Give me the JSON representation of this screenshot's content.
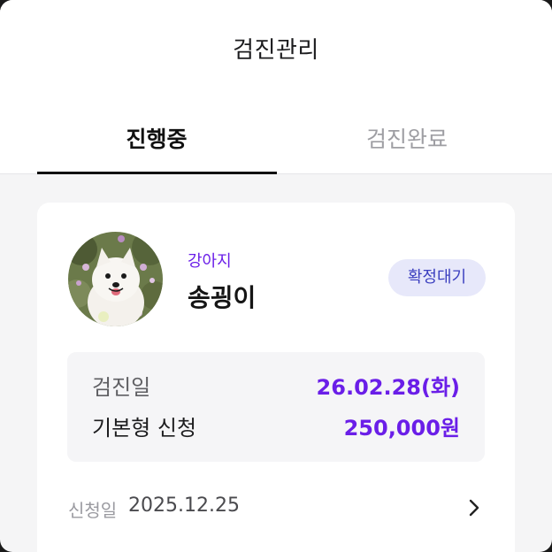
{
  "header": {
    "title": "검진관리"
  },
  "tabs": [
    {
      "label": "진행중",
      "active": true
    },
    {
      "label": "검진완료",
      "active": false
    }
  ],
  "card": {
    "species": "강아지",
    "pet_name": "송굉이",
    "status_badge": "확정대기",
    "info": {
      "exam_date_label": "검진일",
      "exam_date_value": "26.02.28(화)",
      "plan_label": "기본형 신청",
      "plan_value": "250,000원"
    },
    "apply_label": "신청일",
    "apply_date": "2025.12.25"
  },
  "colors": {
    "accent": "#6a1ee8",
    "badge_bg": "#e7e8fa",
    "badge_text": "#3b3fbf",
    "page_bg": "#f5f5f6"
  },
  "icons": {
    "avatar": "dog-photo",
    "chevron": "chevron-right-icon"
  }
}
